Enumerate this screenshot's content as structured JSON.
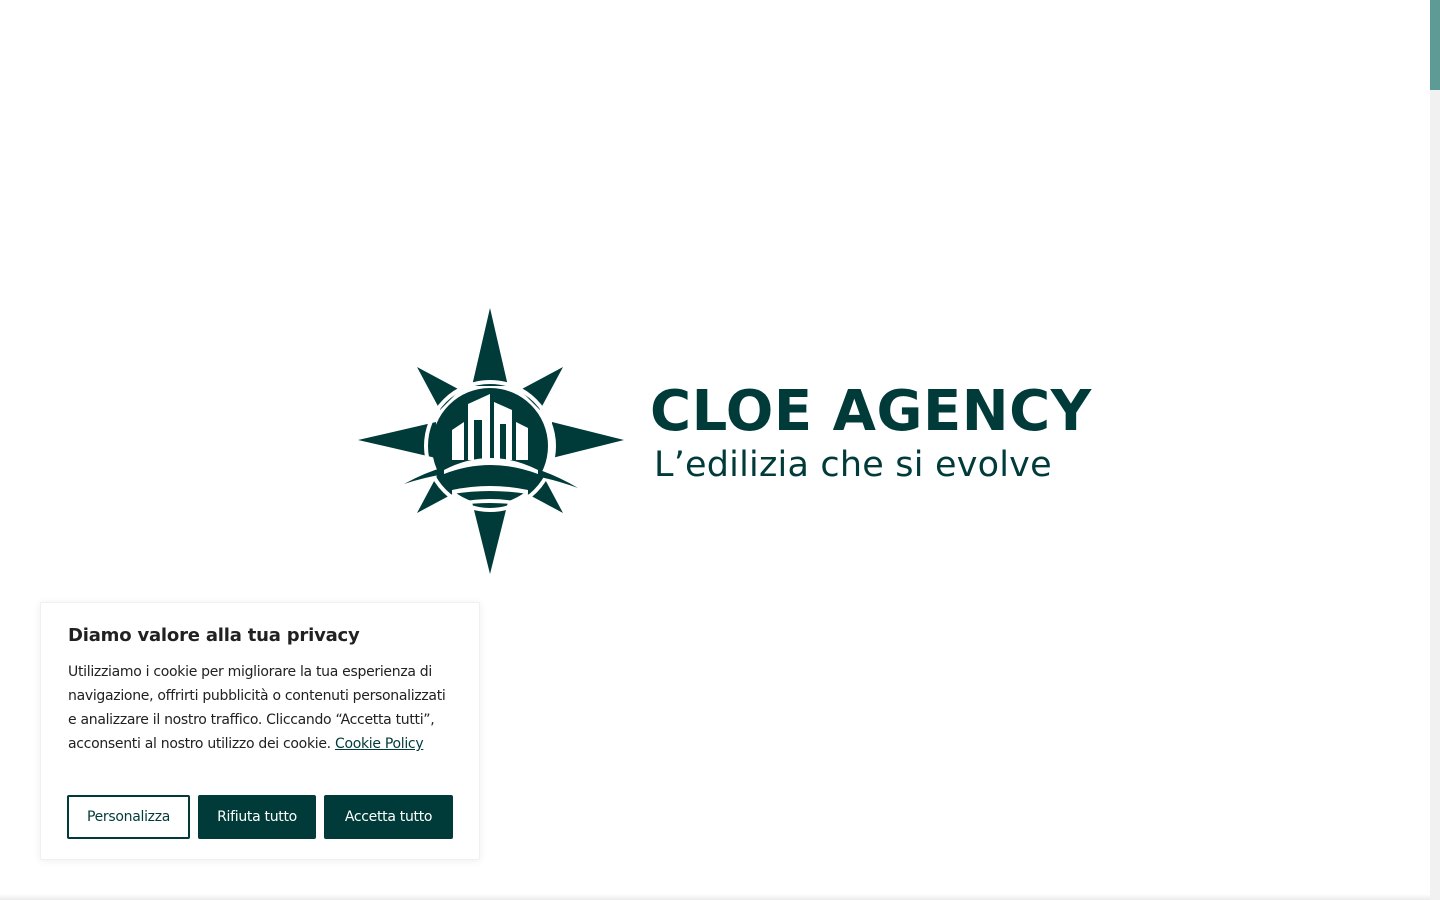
{
  "brand": {
    "name": "CLOE AGENCY",
    "tagline": "L’edilizia che si evolve",
    "logo_icon": "compass-star-building-icon",
    "color": "#003b3a"
  },
  "cookie_banner": {
    "title": "Diamo valore alla tua privacy",
    "text": "Utilizziamo i cookie per migliorare la tua esperienza di navigazione, offrirti pubblicità o contenuti personalizzati e analizzare il nostro traffico. Cliccando “Accetta tutti”, acconsenti al nostro utilizzo dei cookie.",
    "policy_link": "Cookie Policy",
    "buttons": {
      "customize": "Personalizza",
      "reject": "Rifiuta tutto",
      "accept": "Accetta tutto"
    }
  },
  "colors": {
    "primary": "#003b3a",
    "scrollbar_thumb": "#5e9a96",
    "text": "#212121"
  }
}
